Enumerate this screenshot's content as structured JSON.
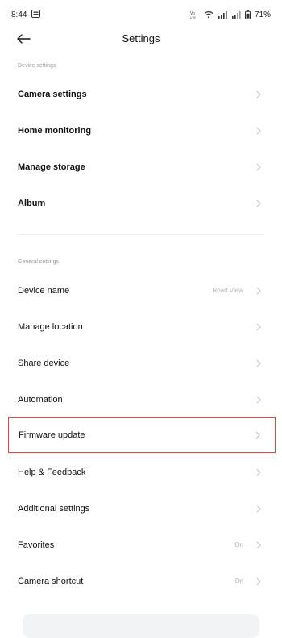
{
  "status": {
    "time": "8:44",
    "battery": "71%"
  },
  "header": {
    "title": "Settings"
  },
  "sections": {
    "device_label": "Device settings",
    "general_label": "General settings"
  },
  "device_items": [
    {
      "label": "Camera settings"
    },
    {
      "label": "Home monitoring"
    },
    {
      "label": "Manage storage"
    },
    {
      "label": "Album"
    }
  ],
  "general_items": [
    {
      "label": "Device name",
      "value": "Road View"
    },
    {
      "label": "Manage location"
    },
    {
      "label": "Share device"
    },
    {
      "label": "Automation"
    },
    {
      "label": "Firmware update"
    },
    {
      "label": "Help & Feedback"
    },
    {
      "label": "Additional settings"
    },
    {
      "label": "Favorites",
      "value": "On"
    },
    {
      "label": "Camera shortcut",
      "value": "On"
    }
  ],
  "colors": {
    "highlight_border": "#e0483a",
    "muted_text": "#9a9a9a",
    "chevron": "#c4c4c4"
  }
}
